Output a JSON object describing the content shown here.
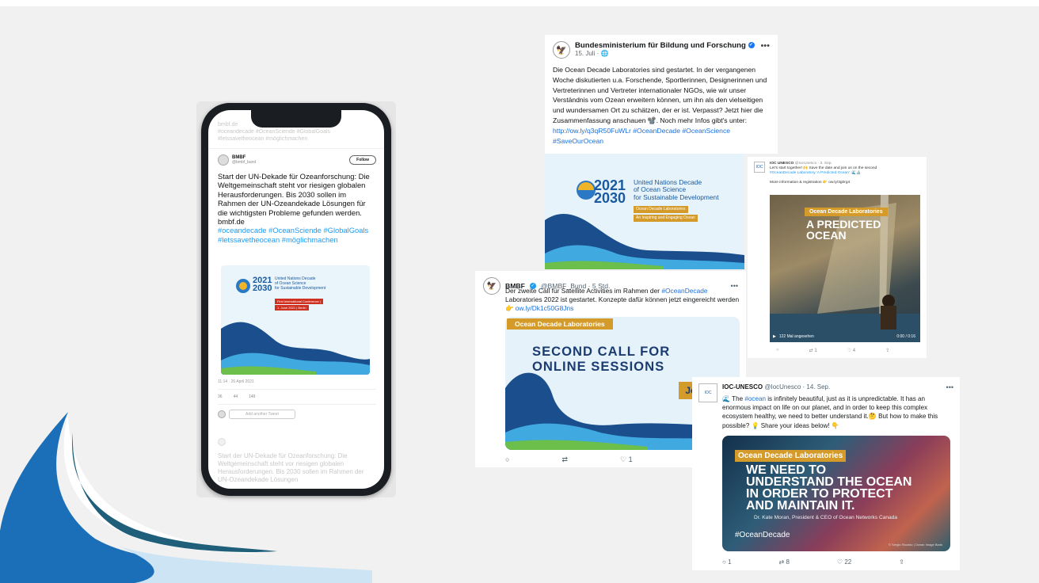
{
  "colors": {
    "background": "#f1f1f1",
    "accent_gold": "#d49a2a",
    "twitter_blue": "#1d9bf0",
    "navy": "#1b3c71",
    "un_blue": "#1a5aa0"
  },
  "phone": {
    "top_faded_line1": "bmbf.de",
    "top_faded_line2": "#oceandecade #OceanSciende #GlobalGoals",
    "top_faded_line3": "#letssavetheocean #möglichmachen",
    "name": "BMBF",
    "handle": "@bmbf_bund",
    "follow_label": "Follow",
    "text": "Start der UN-Dekade für Ozeanforschung: Die Weltgemeinschaft steht vor riesigen globalen Herausforderungen. Bis 2030 sollen im Rahmen der UN-Ozeandekade Lösungen für die wichtigsten Probleme gefunden werden.",
    "link": "bmbf.de",
    "hashtags": "#oceandecade #OceanSciende #GlobalGoals #letssavetheocean #möglichmachen",
    "card": {
      "years": "2021\n2030",
      "title_line1": "United Nations Decade",
      "title_line2": "of Ocean Science",
      "title_line3": "for Sustainable Development",
      "tag1": "First International Conference |",
      "tag2": "1. June 2021 | Berlin"
    },
    "meta": "11:14 · 26 April 2021",
    "actions": {
      "retweets": "36",
      "quotes": "44",
      "likes": "149"
    },
    "reply_placeholder": "Add another Tweet",
    "faded_bottom": "Start der UN-Dekade für Ozeanforschung: Die Weltgemeinschaft steht vor riesigen globalen Herausforderungen. Bis 2030 sollen im Rahmen der UN-Ozeandekade Lösungen"
  },
  "fb_post": {
    "page_name": "Bundesministerium für Bildung und Forschung",
    "date": "15. Juli · ",
    "text": "Die Ocean Decade Laboratories sind gestartet. In der vergangenen Woche diskutierten u.a. Forschende, Sportlerinnen, Designerinnen und Vertreterinnen und Vertreter internationaler NGOs, wie wir unser Verständnis vom Ozean erweitern können, um ihn als den vielseitigen und wundersamen Ort zu schätzen, der er ist. Verpasst? Jetzt hier die Zusammenfassung anschauen 📽️. Noch mehr Infos gibt's unter:",
    "links": "http://ow.ly/q3qR50FuWLr #OceanDecade #OceanScience #SaveOurOcean"
  },
  "un_card": {
    "years_top": "2021",
    "years_bottom": "2030",
    "title_line1": "United Nations Decade",
    "title_line2": "of Ocean Science",
    "title_line3": "for Sustainable Development",
    "tag1": "Ocean Decade Laboratories",
    "tag2": "An Inspiring and Engaging Ocean"
  },
  "ioc_tweet1": {
    "name": "IOC UNESCO",
    "handle": "@IocUnesco · 3. Sep.",
    "text1": "Let's start together! 🙌 Save the date and join us on the second",
    "text2": "#OceanDecade Laboratory 'A Predicted Ocean'. 🌊🔬",
    "text3": "More information & registration 👉 ow.ly/3g0rg4",
    "label": "Ocean Decade Laboratories",
    "headline_line1": "A PREDICTED",
    "headline_line2": "OCEAN",
    "views": "122 Mal angesehen",
    "time": "0:00 / 0:16",
    "actions": {
      "retweets": "1",
      "likes": "4"
    }
  },
  "bmbf_tweet2": {
    "name": "BMBF",
    "handle": "@BMBF_Bund · 5 Std.",
    "text_part1": "Der zweite Call für Satellite Activities im Rahmen der ",
    "text_hashtag": "#OceanDecade",
    "text_part2": " Laboratories 2022 ist gestartet. Konzepte dafür können jetzt eingereicht werden 👉 ",
    "text_link": "ow.ly/Dk1c50G8Jns",
    "label": "Ocean Decade Laboratories",
    "headline_line1": "SECOND CALL FOR",
    "headline_line2": "ONLINE SESSIONS",
    "jetzt": "Jetzt bewe",
    "likes": "1"
  },
  "ioc_tweet2": {
    "name": "IOC-UNESCO",
    "handle": "@IocUnesco · 14. Sep.",
    "text_part1": "🌊 The ",
    "text_hashtag": "#ocean",
    "text_part2": " is infinitely beautiful, just as it is unpredictable. It has an enormous impact on life on our planet, and in order to keep this complex ecosystem healthy, we need to better understand it.🤔 But how to make this possible? 💡 Share your ideas below! 👇",
    "label": "Ocean Decade Laboratories",
    "headline_line1": "WE NEED TO",
    "headline_line2": "UNDERSTAND THE OCEAN",
    "headline_line3": "IN ORDER TO PROTECT",
    "headline_line4": "AND MAINTAIN IT.",
    "quote": "Dr. Kate Moran, President & CEO of Ocean Networks Canada",
    "hashtag": "#OceanDecade",
    "credit": "© Sergio Ricardo | Ocean Image Bank",
    "actions": {
      "replies": "1",
      "retweets": "8",
      "likes": "22"
    }
  }
}
